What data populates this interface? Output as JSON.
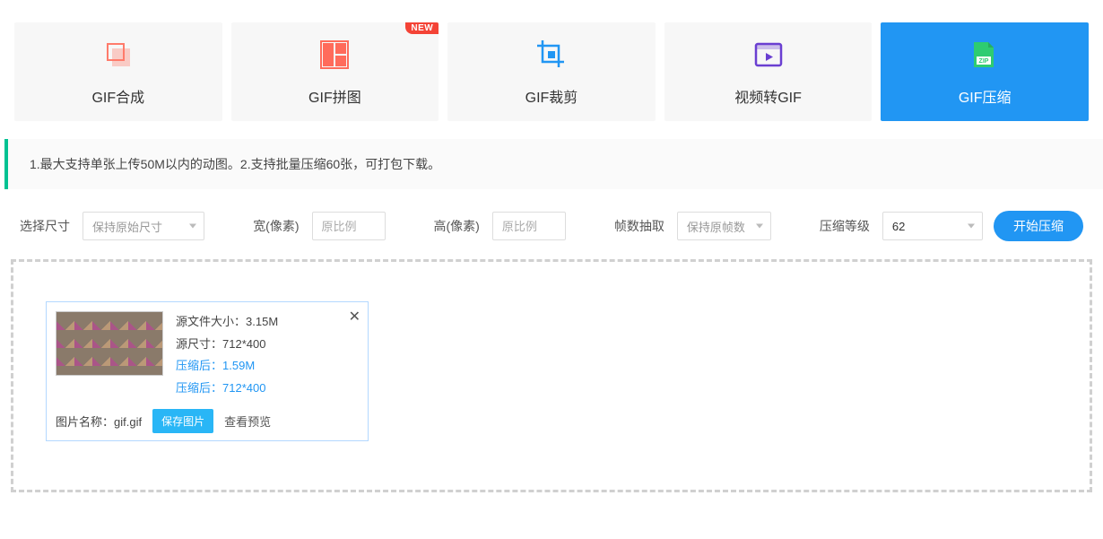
{
  "tabs": [
    {
      "label": "GIF合成",
      "iconColor": "#ff6b5b"
    },
    {
      "label": "GIF拼图",
      "iconColor": "#ff6b5b",
      "badge": "NEW"
    },
    {
      "label": "GIF裁剪",
      "iconColor": "#2196f3"
    },
    {
      "label": "视频转GIF",
      "iconColor": "#6a3fd1"
    },
    {
      "label": "GIF压缩",
      "active": true
    }
  ],
  "notice": "1.最大支持单张上传50M以内的动图。2.支持批量压缩60张，可打包下载。",
  "controls": {
    "size_label": "选择尺寸",
    "size_value": "保持原始尺寸",
    "width_label": "宽(像素)",
    "width_ph": "原比例",
    "height_label": "高(像素)",
    "height_ph": "原比例",
    "frames_label": "帧数抽取",
    "frames_value": "保持原帧数",
    "quality_label": "压缩等级",
    "quality_value": "62",
    "start_btn": "开始压缩"
  },
  "result": {
    "src_size_label": "源文件大小：",
    "src_size_value": "3.15M",
    "src_dim_label": "源尺寸：",
    "src_dim_value": "712*400",
    "out_size_label": "压缩后：",
    "out_size_value": "1.59M",
    "out_dim_label": "压缩后：",
    "out_dim_value": "712*400",
    "name_label": "图片名称：",
    "name_value": "gif.gif",
    "save_btn": "保存图片",
    "preview_link": "查看预览"
  }
}
